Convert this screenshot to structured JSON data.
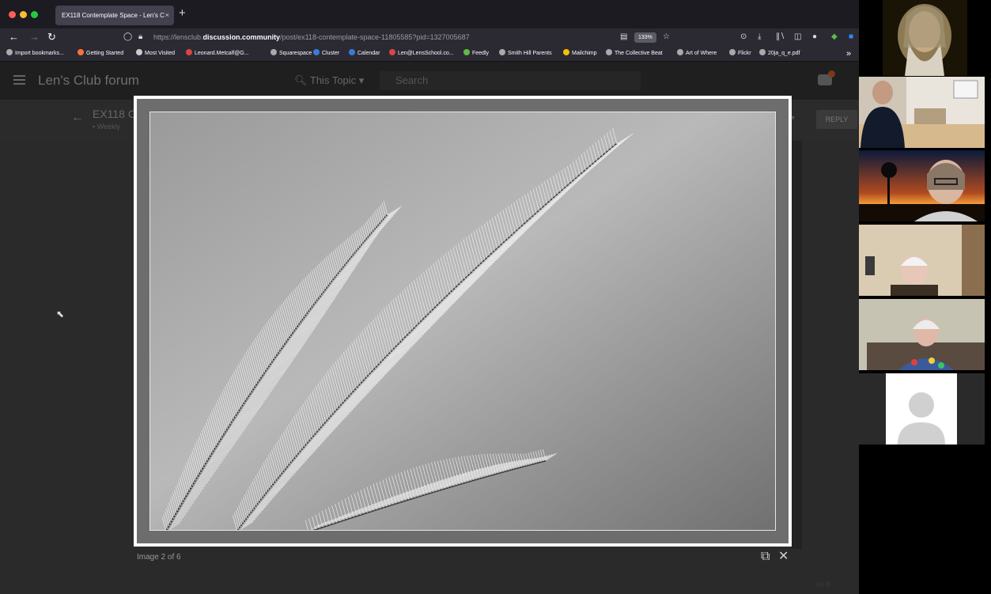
{
  "browser": {
    "tab_title": "EX118 Contemplate Space - Len's C",
    "tab_close": "×",
    "new_tab": "+",
    "url_prefix": "https://lensclub.",
    "url_domain": "discussion.community",
    "url_path": "/post/ex118-contemplate-space-11805585?pid=1327005687",
    "zoom": "133%",
    "bookmarks": [
      "Import bookmarks...",
      "Getting Started",
      "Most Visited",
      "Leonard.Metcalf@G...",
      "Squarespace",
      "Cluster",
      "Calendar",
      "Len@LensSchool.co...",
      "Feedly",
      "Smith Hill Parents",
      "Mailchimp",
      "The Collective Beat",
      "Art of Where",
      "Flickr",
      "20ja_q_e.pdf"
    ],
    "bookmarks_overflow": "»"
  },
  "forum": {
    "site_title": "Len's Club forum",
    "search_scope": "This Topic",
    "search_placeholder": "Search",
    "topic_title": "EX118 C",
    "topic_category": "Weekly",
    "reply_label": "REPLY",
    "like_count": "0"
  },
  "lightbox": {
    "caption": "Image 2 of 6",
    "open_icon": "external-link-icon",
    "close_icon": "close-icon"
  },
  "colors": {
    "accent_orange": "#ff7139",
    "page_bg": "#141414",
    "lightbox_frame": "#ffffff"
  }
}
